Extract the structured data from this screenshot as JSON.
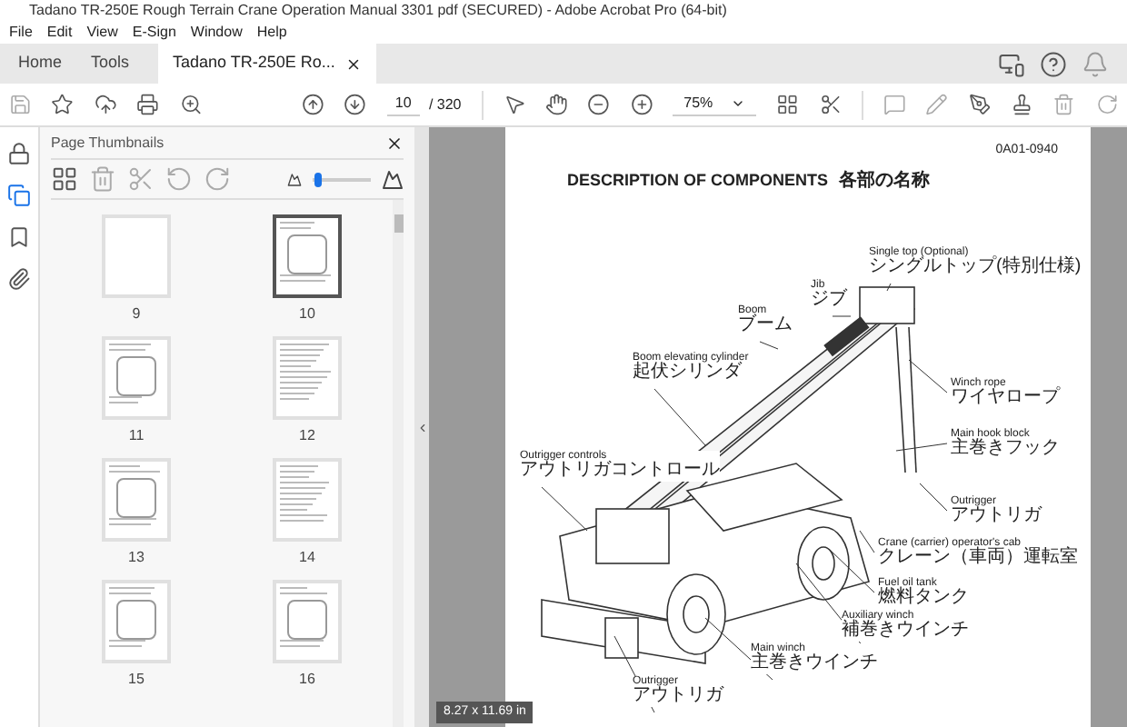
{
  "window": {
    "title": "Tadano TR-250E Rough Terrain Crane Operation Manual 3301 pdf (SECURED) - Adobe Acrobat Pro (64-bit)"
  },
  "menu": [
    "File",
    "Edit",
    "View",
    "E-Sign",
    "Window",
    "Help"
  ],
  "tabs": [
    {
      "label": "Home",
      "selected": false
    },
    {
      "label": "Tools",
      "selected": false
    },
    {
      "label": "Tadano TR-250E Ro...",
      "selected": true
    }
  ],
  "toolbar": {
    "page": "10",
    "total": "/ 320",
    "zoom": "75%"
  },
  "rail": [
    {
      "kind": "lock",
      "selected": false
    },
    {
      "kind": "pages",
      "selected": true
    },
    {
      "kind": "bookmark",
      "selected": false
    },
    {
      "kind": "attachment",
      "selected": false
    }
  ],
  "panel": {
    "title": "Page Thumbnails",
    "thumb_size": {
      "level": 0.1
    },
    "thumbnails": [
      {
        "label": "9",
        "kind": "blank",
        "selected": false
      },
      {
        "label": "10",
        "kind": "diagram",
        "selected": true
      },
      {
        "label": "11",
        "kind": "diagram",
        "selected": false
      },
      {
        "label": "12",
        "kind": "list",
        "selected": false
      },
      {
        "label": "13",
        "kind": "diagram",
        "selected": false
      },
      {
        "label": "14",
        "kind": "list",
        "selected": false
      },
      {
        "label": "15",
        "kind": "diagram",
        "selected": false
      },
      {
        "label": "16",
        "kind": "diagram",
        "selected": false
      }
    ]
  },
  "document": {
    "page_id": "0A01-0940",
    "heading": "DESCRIPTION OF COMPONENTS",
    "heading_ja": "各部の名称",
    "callouts": [
      {
        "en": "Single top (Optional)",
        "ja": "シングルトップ(特別仕様)"
      },
      {
        "en": "Jib",
        "ja": "ジブ"
      },
      {
        "en": "Boom",
        "ja": "ブーム"
      },
      {
        "en": "Boom elevating cylinder",
        "ja": "起伏シリンダ"
      },
      {
        "en": "Winch rope",
        "ja": "ワイヤロープ"
      },
      {
        "en": "Main hook block",
        "ja": "主巻きフック"
      },
      {
        "en": "Outrigger controls",
        "ja": "アウトリガコントロール"
      },
      {
        "en": "Outrigger",
        "ja": "アウトリガ"
      },
      {
        "en": "Crane (carrier) operator's cab",
        "ja": "クレーン（車両）運転室"
      },
      {
        "en": "Fuel oil tank",
        "ja": "燃料タンク"
      },
      {
        "en": "Auxiliary winch",
        "ja": "補巻きウインチ"
      },
      {
        "en": "Main winch",
        "ja": "主巻きウインチ"
      },
      {
        "en": "Outrigger",
        "ja": "アウトリガ"
      }
    ],
    "page_size": "8.27 x 11.69 in"
  }
}
